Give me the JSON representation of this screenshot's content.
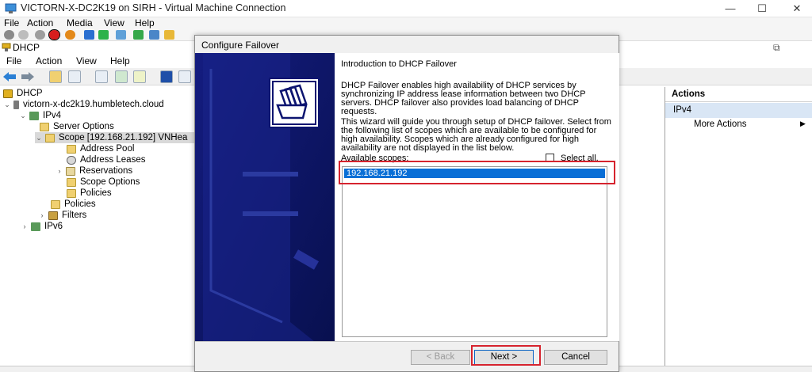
{
  "vm_window": {
    "title": "VICTORN-X-DC2K19 on SIRH - Virtual Machine Connection",
    "controls": {
      "minimize": "—",
      "maximize": "☐",
      "close": "✕"
    },
    "menu": [
      "File",
      "Action",
      "Media",
      "View",
      "Help"
    ]
  },
  "mmc": {
    "title": "DHCP",
    "menu": [
      "File",
      "Action",
      "View",
      "Help"
    ],
    "restore_glyph": "⧉",
    "tree": {
      "root": "DHCP",
      "server": "victorn-x-dc2k19.humbletech.cloud",
      "ipv4": "IPv4",
      "server_options": "Server Options",
      "scope": "Scope [192.168.21.192] VNHea",
      "address_pool": "Address Pool",
      "address_leases": "Address Leases",
      "reservations": "Reservations",
      "scope_options": "Scope Options",
      "scope_policies": "Policies",
      "policies": "Policies",
      "filters": "Filters",
      "ipv6": "IPv6"
    },
    "actions": {
      "header": "Actions",
      "selected": "IPv4",
      "more": "More Actions",
      "more_arrow": "▶"
    }
  },
  "wizard": {
    "title": "Configure Failover",
    "heading": "Introduction to DHCP Failover",
    "para1": "DHCP Failover enables high availability of DHCP services by synchronizing IP address lease information between two DHCP servers. DHCP failover also provides load balancing of DHCP requests.",
    "para2": "This wizard will guide you through setup of DHCP failover. Select from the following list of scopes which are available to be configured for high availability. Scopes which are already configured for high availability are not displayed in the list below.",
    "available_label": "Available scopes:",
    "select_all": "Select all.",
    "scopes": [
      "192.168.21.192"
    ],
    "back": "< Back",
    "next": "Next >",
    "cancel": "Cancel"
  },
  "colors": {
    "banner": "#0c1470",
    "selection": "#0a6fd6",
    "highlight_box": "#d6232e"
  }
}
